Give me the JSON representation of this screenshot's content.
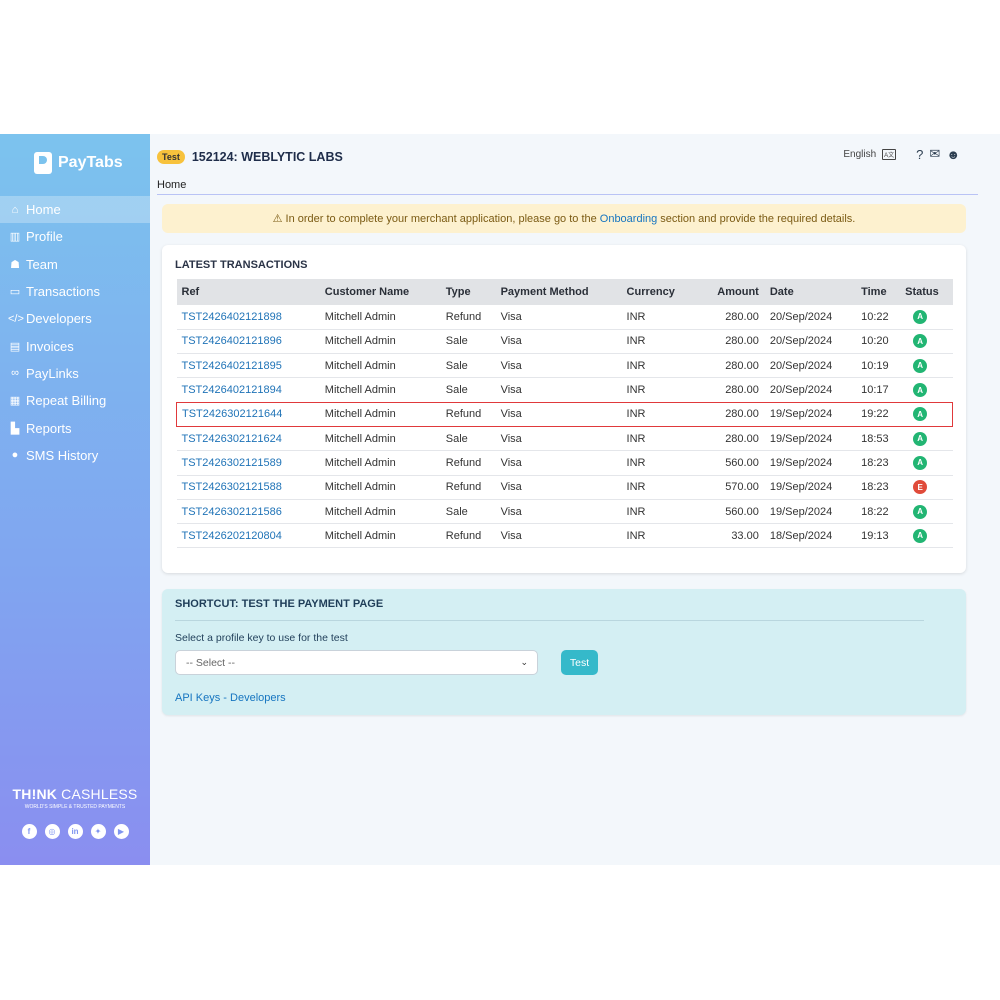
{
  "brand": {
    "name": "PayTabs",
    "think": "TH!NK",
    "cashless": "CASHLESS",
    "tagline": "WORLD'S SIMPLE & TRUSTED PAYMENTS"
  },
  "sidebar": {
    "items": [
      {
        "label": "Home",
        "icon": "home-icon",
        "glyph": "⌂"
      },
      {
        "label": "Profile",
        "icon": "bank-icon",
        "glyph": "▥"
      },
      {
        "label": "Team",
        "icon": "team-icon",
        "glyph": "☗"
      },
      {
        "label": "Transactions",
        "icon": "card-icon",
        "glyph": "▭"
      },
      {
        "label": "Developers",
        "icon": "code-icon",
        "glyph": "</>"
      },
      {
        "label": "Invoices",
        "icon": "invoice-icon",
        "glyph": "▤"
      },
      {
        "label": "PayLinks",
        "icon": "link-icon",
        "glyph": "∞"
      },
      {
        "label": "Repeat Billing",
        "icon": "calendar-icon",
        "glyph": "▦"
      },
      {
        "label": "Reports",
        "icon": "chart-icon",
        "glyph": "▙"
      },
      {
        "label": "SMS History",
        "icon": "sms-icon",
        "glyph": "●"
      }
    ],
    "socials": [
      {
        "icon": "facebook-icon",
        "glyph": "f"
      },
      {
        "icon": "instagram-icon",
        "glyph": "◎"
      },
      {
        "icon": "linkedin-icon",
        "glyph": "in"
      },
      {
        "icon": "twitter-icon",
        "glyph": "✦"
      },
      {
        "icon": "youtube-icon",
        "glyph": "▶"
      }
    ]
  },
  "header": {
    "badge": "Test",
    "merchant": "152124: WEBLYTIC LABS",
    "language": "English",
    "breadcrumb": "Home"
  },
  "alert": {
    "before": "In order to complete your merchant application, please go to the",
    "link": "Onboarding",
    "after": "section and provide the required details."
  },
  "transactions": {
    "title": "LATEST TRANSACTIONS",
    "columns": [
      "Ref",
      "Customer Name",
      "Type",
      "Payment Method",
      "Currency",
      "Amount",
      "Date",
      "Time",
      "Status"
    ],
    "rows": [
      {
        "ref": "TST2426402121898",
        "customer": "Mitchell Admin",
        "type": "Refund",
        "method": "Visa",
        "currency": "INR",
        "amount": "280.00",
        "date": "20/Sep/2024",
        "time": "10:22",
        "status": "A"
      },
      {
        "ref": "TST2426402121896",
        "customer": "Mitchell Admin",
        "type": "Sale",
        "method": "Visa",
        "currency": "INR",
        "amount": "280.00",
        "date": "20/Sep/2024",
        "time": "10:20",
        "status": "A"
      },
      {
        "ref": "TST2426402121895",
        "customer": "Mitchell Admin",
        "type": "Sale",
        "method": "Visa",
        "currency": "INR",
        "amount": "280.00",
        "date": "20/Sep/2024",
        "time": "10:19",
        "status": "A"
      },
      {
        "ref": "TST2426402121894",
        "customer": "Mitchell Admin",
        "type": "Sale",
        "method": "Visa",
        "currency": "INR",
        "amount": "280.00",
        "date": "20/Sep/2024",
        "time": "10:17",
        "status": "A"
      },
      {
        "ref": "TST2426302121644",
        "customer": "Mitchell Admin",
        "type": "Refund",
        "method": "Visa",
        "currency": "INR",
        "amount": "280.00",
        "date": "19/Sep/2024",
        "time": "19:22",
        "status": "A",
        "highlight": true
      },
      {
        "ref": "TST2426302121624",
        "customer": "Mitchell Admin",
        "type": "Sale",
        "method": "Visa",
        "currency": "INR",
        "amount": "280.00",
        "date": "19/Sep/2024",
        "time": "18:53",
        "status": "A"
      },
      {
        "ref": "TST2426302121589",
        "customer": "Mitchell Admin",
        "type": "Refund",
        "method": "Visa",
        "currency": "INR",
        "amount": "560.00",
        "date": "19/Sep/2024",
        "time": "18:23",
        "status": "A"
      },
      {
        "ref": "TST2426302121588",
        "customer": "Mitchell Admin",
        "type": "Refund",
        "method": "Visa",
        "currency": "INR",
        "amount": "570.00",
        "date": "19/Sep/2024",
        "time": "18:23",
        "status": "E"
      },
      {
        "ref": "TST2426302121586",
        "customer": "Mitchell Admin",
        "type": "Sale",
        "method": "Visa",
        "currency": "INR",
        "amount": "560.00",
        "date": "19/Sep/2024",
        "time": "18:22",
        "status": "A"
      },
      {
        "ref": "TST2426202120804",
        "customer": "Mitchell Admin",
        "type": "Refund",
        "method": "Visa",
        "currency": "INR",
        "amount": "33.00",
        "date": "18/Sep/2024",
        "time": "19:13",
        "status": "A"
      }
    ]
  },
  "shortcut": {
    "title": "SHORTCUT: TEST THE PAYMENT PAGE",
    "label": "Select a profile key to use for the test",
    "select_value": "-- Select --",
    "button": "Test",
    "link": "API Keys - Developers"
  },
  "colors": {
    "status_A": "#22b573",
    "status_E": "#e04b3a",
    "accent": "#35b9ca"
  }
}
